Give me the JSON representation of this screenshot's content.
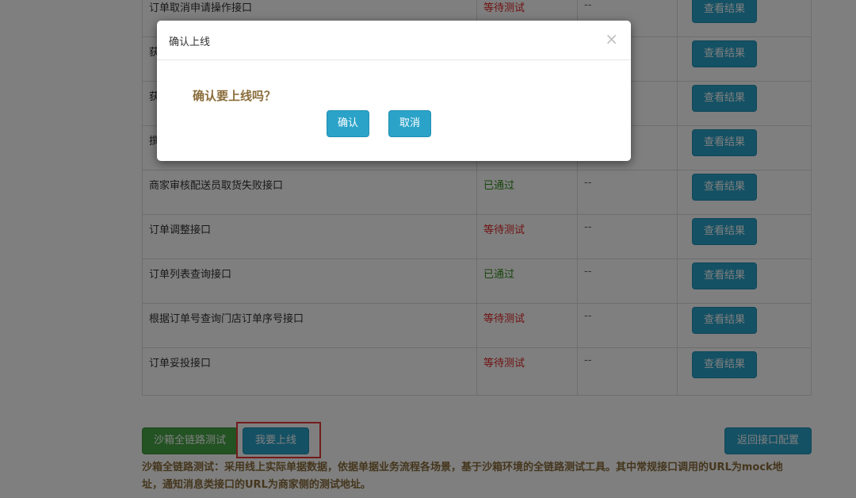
{
  "table": {
    "rows": [
      {
        "name": "订单取消申请操作接口",
        "status": "等待测试",
        "status_type": "pending",
        "remark": "--",
        "action": "查看结果"
      },
      {
        "name": "获",
        "status": "",
        "status_type": "",
        "remark": "",
        "action": "查看结果"
      },
      {
        "name": "获",
        "status": "",
        "status_type": "",
        "remark": "",
        "action": "查看结果"
      },
      {
        "name": "撰",
        "status": "",
        "status_type": "",
        "remark": "",
        "action": "查看结果"
      },
      {
        "name": "商家审核配送员取货失败接口",
        "status": "已通过",
        "status_type": "passed",
        "remark": "--",
        "action": "查看结果"
      },
      {
        "name": "订单调整接口",
        "status": "等待测试",
        "status_type": "pending",
        "remark": "--",
        "action": "查看结果"
      },
      {
        "name": "订单列表查询接口",
        "status": "已通过",
        "status_type": "passed",
        "remark": "--",
        "action": "查看结果"
      },
      {
        "name": "根据订单号查询门店订单序号接口",
        "status": "等待测试",
        "status_type": "pending",
        "remark": "--",
        "action": "查看结果"
      },
      {
        "name": "订单妥投接口",
        "status": "等待测试",
        "status_type": "pending",
        "remark": "--",
        "action": "查看结果"
      }
    ]
  },
  "footer": {
    "sandbox_label": "沙箱全链路测试",
    "go_live_label": "我要上线",
    "back_label": "返回接口配置",
    "description": "沙箱全链路测试：采用线上实际单据数据，依据单据业务流程各场景，基于沙箱环境的全链路测试工具。其中常规接口调用的URL为mock地址，通知消息类接口的URL为商家侧的测试地址。"
  },
  "modal": {
    "title": "确认上线",
    "close": "×",
    "question": "确认要上线吗？",
    "confirm_label": "确认",
    "cancel_label": "取消"
  },
  "colors": {
    "pending": "#e02424",
    "passed": "#2e8a17",
    "primary_button": "#2ba3c9",
    "success_button": "#46a546",
    "highlight": "#e53935",
    "description_text": "#8a6d3b"
  }
}
